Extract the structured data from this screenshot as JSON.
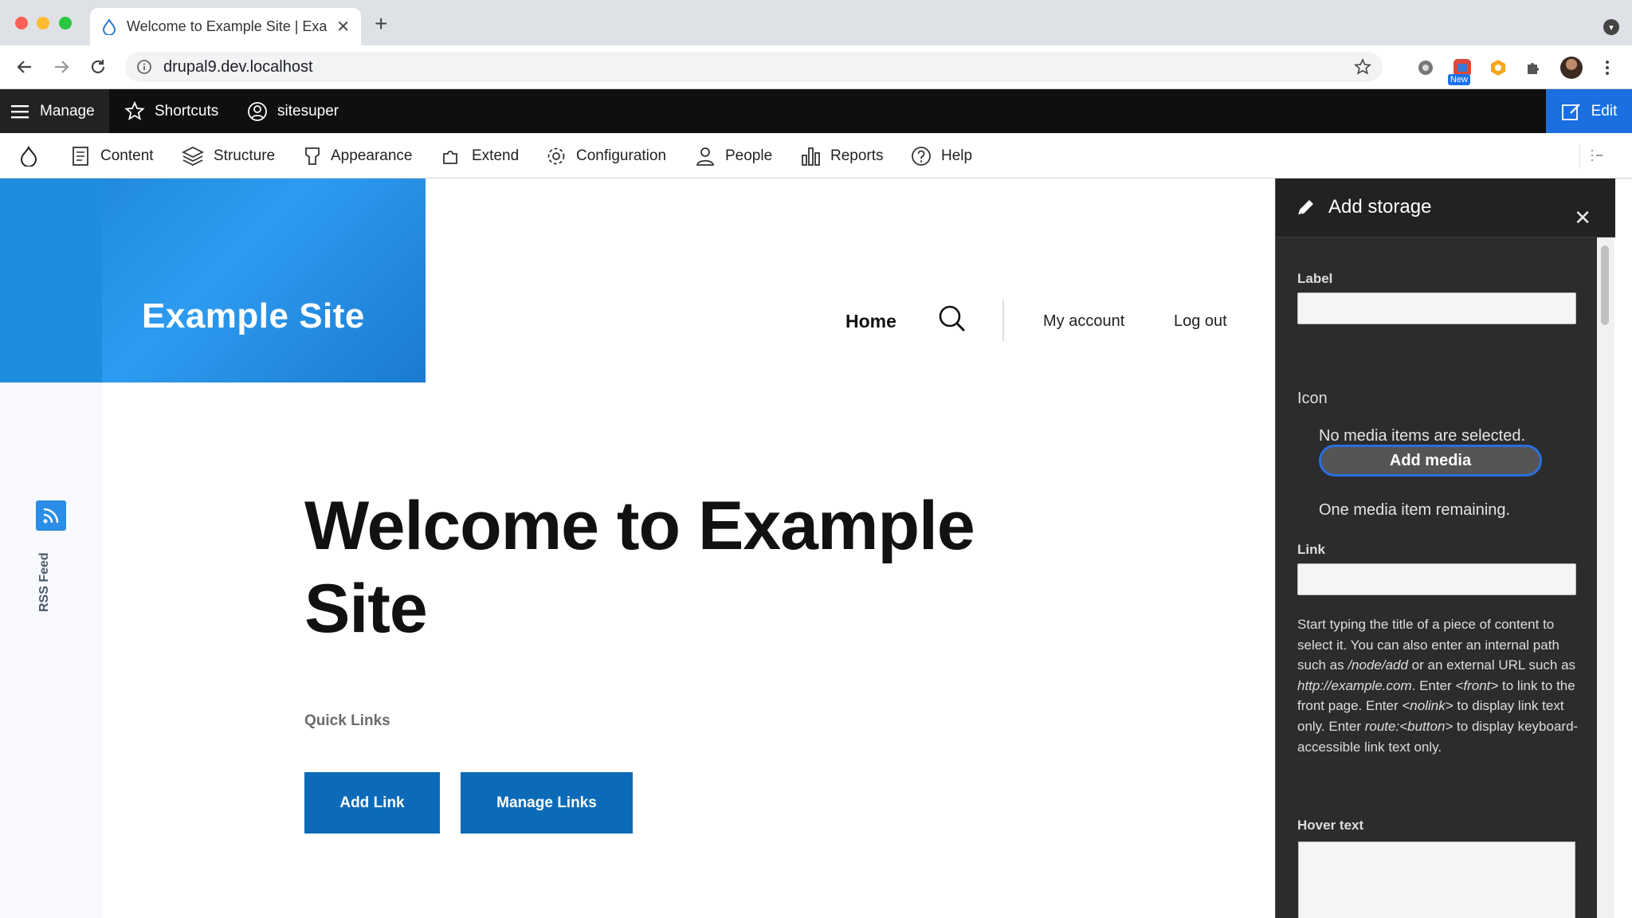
{
  "browser": {
    "tab_title": "Welcome to Example Site | Exa",
    "url": "drupal9.dev.localhost",
    "extension_badge": "New"
  },
  "toolbar": {
    "manage": "Manage",
    "shortcuts": "Shortcuts",
    "user": "sitesuper",
    "edit": "Edit"
  },
  "admin_menu": {
    "content": "Content",
    "structure": "Structure",
    "appearance": "Appearance",
    "extend": "Extend",
    "configuration": "Configuration",
    "people": "People",
    "reports": "Reports",
    "help": "Help"
  },
  "site": {
    "name": "Example Site",
    "nav_home": "Home",
    "nav_account": "My account",
    "nav_logout": "Log out",
    "rss": "RSS Feed",
    "headline": "Welcome to Example Site",
    "quick_links_title": "Quick Links",
    "add_link": "Add Link",
    "manage_links": "Manage Links"
  },
  "offcanvas": {
    "title": "Add storage",
    "label_field": "Label",
    "icon_field": "Icon",
    "no_media": "No media items are selected.",
    "add_media": "Add media",
    "remaining": "One media item remaining.",
    "link_field": "Link",
    "help_1": "Start typing the title of a piece of content to select it. You can also enter an internal path such as ",
    "help_path": "/node/add",
    "help_2": " or an external URL such as ",
    "help_url": "http://example.com",
    "help_3": ". Enter ",
    "help_front": "<front>",
    "help_4": " to link to the front page. Enter ",
    "help_nolink": "<nolink>",
    "help_5": " to display link text only. Enter ",
    "help_button": "route:<button>",
    "help_6": " to display keyboard-accessible link text only.",
    "hover_field": "Hover text"
  },
  "colors": {
    "toolbar_bg": "#0f0f0f",
    "edit_blue": "#1b6fe0",
    "brand_blue": "#1e8ddd",
    "button_blue": "#0b6bb8",
    "offcanvas_bg": "#2c2c2c"
  }
}
